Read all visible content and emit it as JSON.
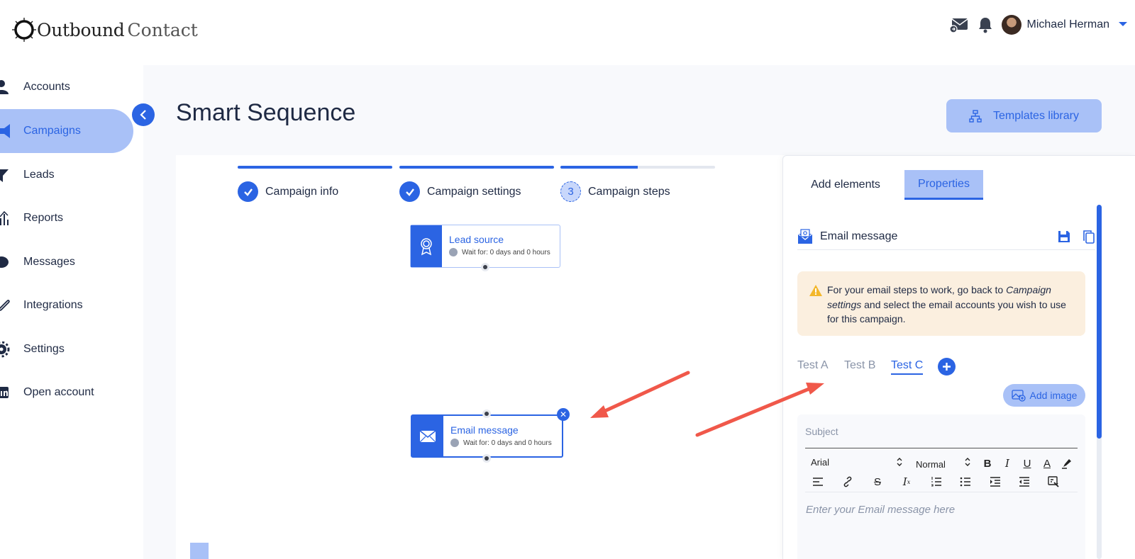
{
  "brand": {
    "part1": "Outbound",
    "part2": "Contact"
  },
  "header": {
    "user_name": "Michael Herman",
    "icons": [
      "mail-icon",
      "bell-icon",
      "avatar",
      "caret-down-icon"
    ]
  },
  "sidebar": {
    "items": [
      {
        "label": "Accounts",
        "icon": "user-icon",
        "active": false
      },
      {
        "label": "Campaigns",
        "icon": "megaphone-icon",
        "active": true
      },
      {
        "label": "Leads",
        "icon": "funnel-icon",
        "active": false
      },
      {
        "label": "Reports",
        "icon": "bar-chart-icon",
        "active": false
      },
      {
        "label": "Messages",
        "icon": "chat-icon",
        "active": false
      },
      {
        "label": "Integrations",
        "icon": "link-icon",
        "active": false
      },
      {
        "label": "Settings",
        "icon": "gear-icon",
        "active": false
      },
      {
        "label": "Open account",
        "icon": "linkedin-icon",
        "active": false
      }
    ]
  },
  "main": {
    "title": "Smart Sequence",
    "templates_button": "Templates library",
    "steps": [
      {
        "label": "Campaign info",
        "state": "done",
        "progress": 1.0
      },
      {
        "label": "Campaign settings",
        "state": "done",
        "progress": 1.0
      },
      {
        "label": "Campaign steps",
        "state": "current",
        "number": "3",
        "progress": 0.5
      }
    ],
    "nodes": [
      {
        "title": "Lead source",
        "wait": "Wait for: 0 days and 0 hours",
        "icon": "award-icon"
      },
      {
        "title": "Email message",
        "wait": "Wait for: 0 days and 0 hours",
        "icon": "envelope-icon",
        "selected": true
      }
    ]
  },
  "panel": {
    "tabs": [
      {
        "label": "Add elements",
        "active": false
      },
      {
        "label": "Properties",
        "active": true
      }
    ],
    "header": "Email message",
    "warning": {
      "pre": "For your email steps to work, go back to ",
      "em": "Campaign settings",
      "post": " and select the email accounts you wish to use for this campaign."
    },
    "variants": [
      {
        "label": "Test A",
        "active": false
      },
      {
        "label": "Test B",
        "active": false
      },
      {
        "label": "Test C",
        "active": true
      }
    ],
    "add_image": "Add image",
    "subject_placeholder": "Subject",
    "font": "Arial",
    "size": "Normal",
    "body_placeholder": "Enter your Email message here"
  },
  "colors": {
    "accent": "#2b64e3",
    "accent_light": "#a9c1f7",
    "warning_bg": "#fbefdf",
    "arrow": "#f0584a"
  }
}
